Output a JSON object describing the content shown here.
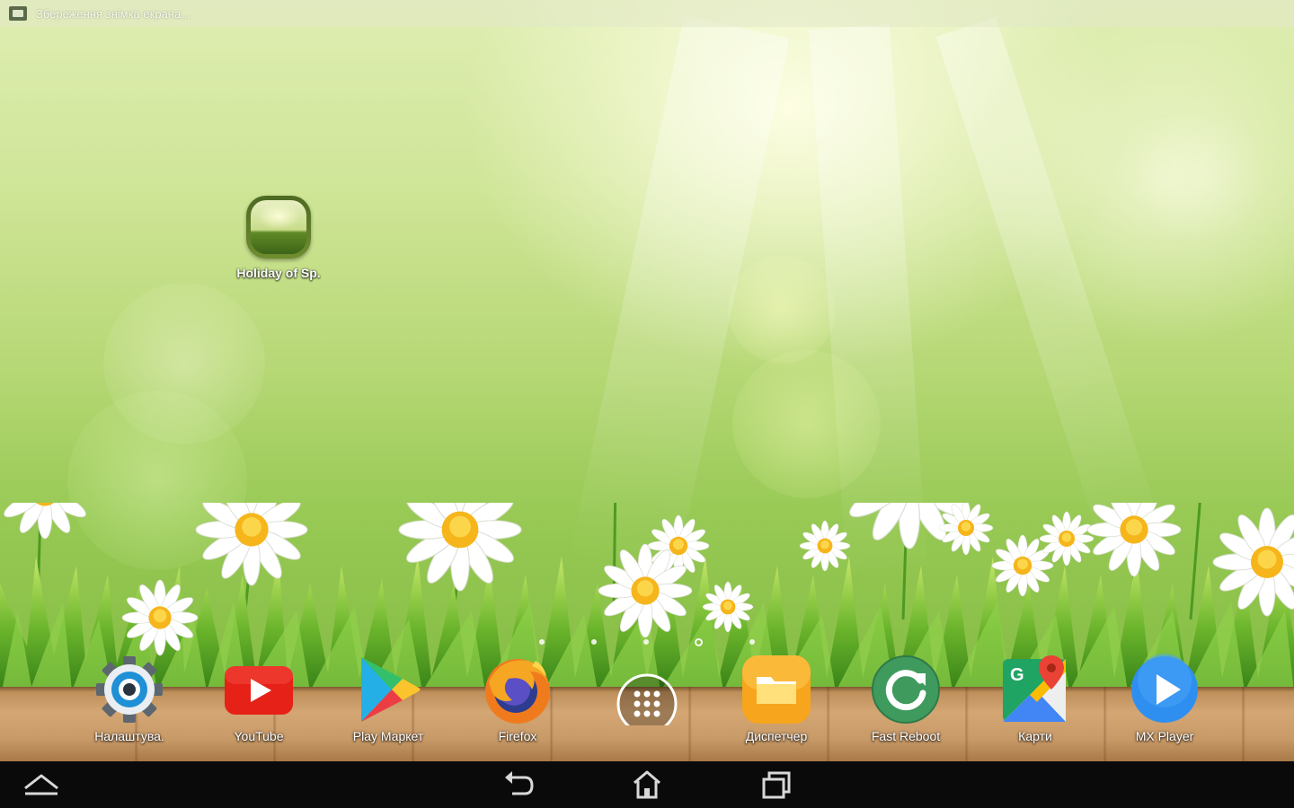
{
  "status_bar": {
    "notification_text": "Збереження знімка екрана...",
    "notification_icon": "screenshot-icon"
  },
  "desktop": {
    "shortcut": {
      "label": "Holiday of Sp.",
      "icon": "wallpaper-app-icon"
    }
  },
  "page_indicator": {
    "pages": 5,
    "active_page": 4
  },
  "dock": {
    "items": [
      {
        "label": "Налаштува.",
        "icon": "settings-gear-icon"
      },
      {
        "label": "YouTube",
        "icon": "youtube-icon"
      },
      {
        "label": "Play Маркет",
        "icon": "play-store-icon"
      },
      {
        "label": "Firefox",
        "icon": "firefox-icon"
      },
      {
        "label": "",
        "icon": "app-drawer-icon"
      },
      {
        "label": "Диспетчер",
        "icon": "file-manager-icon"
      },
      {
        "label": "Fast Reboot",
        "icon": "fast-reboot-icon"
      },
      {
        "label": "Карти",
        "icon": "maps-icon"
      },
      {
        "label": "MX Player",
        "icon": "mx-player-icon"
      }
    ]
  },
  "navigation_bar": {
    "buttons": [
      "up-arrow-icon",
      "back-icon",
      "home-icon",
      "recents-icon"
    ]
  },
  "colors": {
    "navbar": "#0a0a0a",
    "wallpaper_top": "#dfeeb2",
    "wallpaper_bottom": "#7db73d"
  }
}
